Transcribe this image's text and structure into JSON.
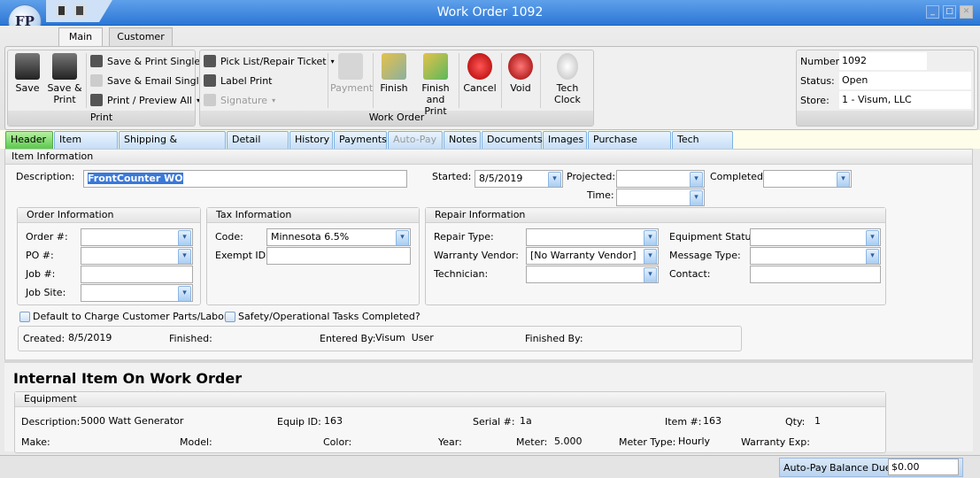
{
  "window": {
    "title": "Work Order 1092",
    "logo_text": "FP"
  },
  "ribbon": {
    "tabs": [
      "Main",
      "Customer"
    ],
    "print_group": {
      "label": "Print",
      "save": "Save",
      "save_print": [
        "Save &",
        "Print"
      ],
      "save_print_single": "Save & Print Single",
      "save_email_single": "Save & Email Single",
      "print_preview_all": "Print / Preview All"
    },
    "work_order_group": {
      "label": "Work Order",
      "pick_list": "Pick List/Repair Ticket",
      "label_print": "Label Print",
      "signature": "Signature",
      "payment": "Payment",
      "finish": "Finish",
      "finish_print": [
        "Finish",
        "and Print"
      ],
      "cancel": "Cancel",
      "void": "Void",
      "tech_clock": "Tech Clock"
    }
  },
  "info": {
    "number_label": "Number:",
    "number": "1092",
    "status_label": "Status:",
    "status": "Open",
    "store_label": "Store:",
    "store": "1 - Visum, LLC"
  },
  "tabs": [
    "Header",
    "Item Details",
    "Shipping & Dispatching",
    "Detail Lines",
    "History",
    "Payments",
    "Auto-Pay",
    "Notes",
    "Documents",
    "Images",
    "Purchase Orders",
    "Tech Hours"
  ],
  "item_info": {
    "title": "Item Information",
    "description_label": "Description:",
    "description": "FrontCounter WO",
    "started_label": "Started:",
    "started": "8/5/2019",
    "projected_label": "Projected:",
    "completed_label": "Completed:",
    "time_label": "Time:"
  },
  "order_info": {
    "title": "Order Information",
    "order_label": "Order #:",
    "po_label": "PO #:",
    "job_label": "Job #:",
    "job_site_label": "Job Site:"
  },
  "tax_info": {
    "title": "Tax Information",
    "code_label": "Code:",
    "code": "Minnesota 6.5%",
    "exempt_label": "Exempt ID:"
  },
  "repair_info": {
    "title": "Repair Information",
    "repair_type_label": "Repair Type:",
    "warranty_vendor_label": "Warranty Vendor:",
    "warranty_vendor": "[No Warranty Vendor]",
    "technician_label": "Technician:",
    "equipment_status_label": "Equipment Status:",
    "message_type_label": "Message Type:",
    "contact_label": "Contact:"
  },
  "checks": {
    "default_charge": "Default to Charge Customer Parts/Labor?",
    "safety": "Safety/Operational Tasks Completed?"
  },
  "audit": {
    "created_label": "Created:",
    "created": "8/5/2019",
    "finished_label": "Finished:",
    "entered_by_label": "Entered By:",
    "entered_by": "Visum  User",
    "finished_by_label": "Finished By:"
  },
  "internal": {
    "title": "Internal Item On Work Order",
    "equipment_title": "Equipment",
    "description_label": "Description:",
    "description": "5000 Watt Generator",
    "equip_id_label": "Equip ID:",
    "equip_id": "163",
    "serial_label": "Serial #:",
    "serial": "1a",
    "item_label": "Item #:",
    "item": "163",
    "qty_label": "Qty:",
    "qty": "1",
    "make_label": "Make:",
    "model_label": "Model:",
    "color_label": "Color:",
    "year_label": "Year:",
    "meter_label": "Meter:",
    "meter": "5.000",
    "meter_type_label": "Meter Type:",
    "meter_type": "Hourly",
    "warranty_exp_label": "Warranty Exp:"
  },
  "statusbar": {
    "autopay": "Auto-Pay",
    "balance_label": "Balance Due:",
    "balance": "$0.00"
  }
}
